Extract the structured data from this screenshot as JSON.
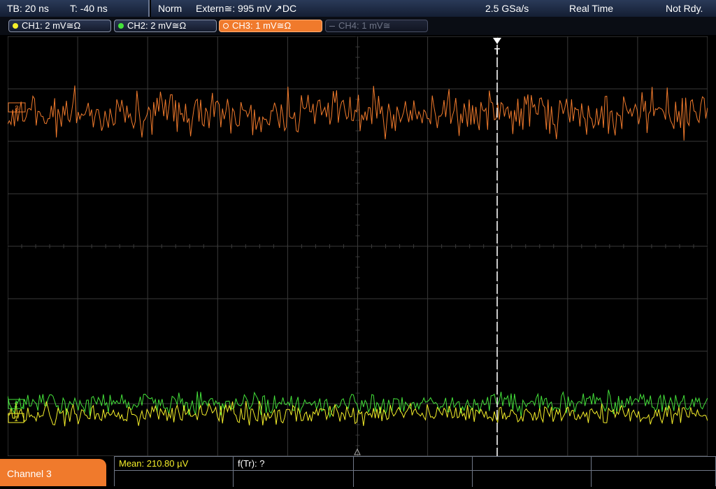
{
  "status": {
    "timebase": "TB: 20 ns",
    "trigger_offset": "T: -40 ns",
    "mode": "Norm",
    "trigger_source": "Extern≅: 995 mV ↗DC",
    "sample_rate": "2.5 GSa/s",
    "acq_mode": "Real Time",
    "run_state": "Not Rdy."
  },
  "channels": [
    {
      "label": "CH1: 2 mV≅Ω",
      "color": "#f5ef2a",
      "active": true
    },
    {
      "label": "CH2: 2 mV≅Ω",
      "color": "#44e23a",
      "active": true
    },
    {
      "label": "CH3: 1 mV≅Ω",
      "color": "#f07a2c",
      "active": true
    },
    {
      "label": "CH4: 1 mV≅",
      "color": "#6e7486",
      "active": false
    }
  ],
  "waveform_markers": {
    "ch3": "3",
    "ch2": "2",
    "ch1": "1",
    "trigger": "T"
  },
  "colors": {
    "ch1": "#f5ef2a",
    "ch2": "#44e23a",
    "ch3": "#f07a2c",
    "grid": "#3a3a3a"
  },
  "measure": {
    "channel_label": "Channel 3",
    "mean": "Mean: 210.80 µV",
    "ftr": "f(Tr): ?"
  }
}
